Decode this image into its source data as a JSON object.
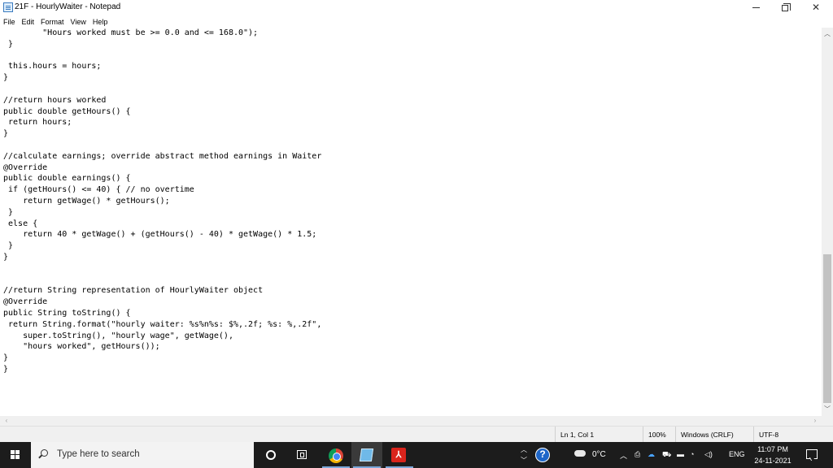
{
  "window": {
    "title": "21F - HourlyWaiter - Notepad",
    "controls": {
      "minimize": "",
      "maximize": "",
      "close": "✕"
    }
  },
  "menu": [
    "File",
    "Edit",
    "Format",
    "View",
    "Help"
  ],
  "editor": {
    "lines": [
      "        \"Hours worked must be >= 0.0 and <= 168.0\");",
      " }",
      "",
      " this.hours = hours;",
      "}",
      "",
      "//return hours worked",
      "public double getHours() {",
      " return hours;",
      "}",
      "",
      "//calculate earnings; override abstract method earnings in Waiter",
      "@Override",
      "public double earnings() {",
      " if (getHours() <= 40) { // no overtime",
      "    return getWage() * getHours();",
      " }",
      " else {",
      "    return 40 * getWage() + (getHours() - 40) * getWage() * 1.5;",
      " }",
      "}",
      "",
      "",
      "//return String representation of HourlyWaiter object",
      "@Override",
      "public String toString() {",
      " return String.format(\"hourly waiter: %s%n%s: $%,.2f; %s: %,.2f\",",
      "    super.toString(), \"hourly wage\", getWage(),",
      "    \"hours worked\", getHours());",
      "}",
      "}"
    ]
  },
  "status": {
    "position": "Ln 1, Col 1",
    "zoom": "100%",
    "line_ending": "Windows (CRLF)",
    "encoding": "UTF-8"
  },
  "taskbar": {
    "search_placeholder": "Type here to search",
    "weather_temp": "0°C",
    "language": "ENG",
    "time": "11:07 PM",
    "date": "24-11-2021"
  }
}
